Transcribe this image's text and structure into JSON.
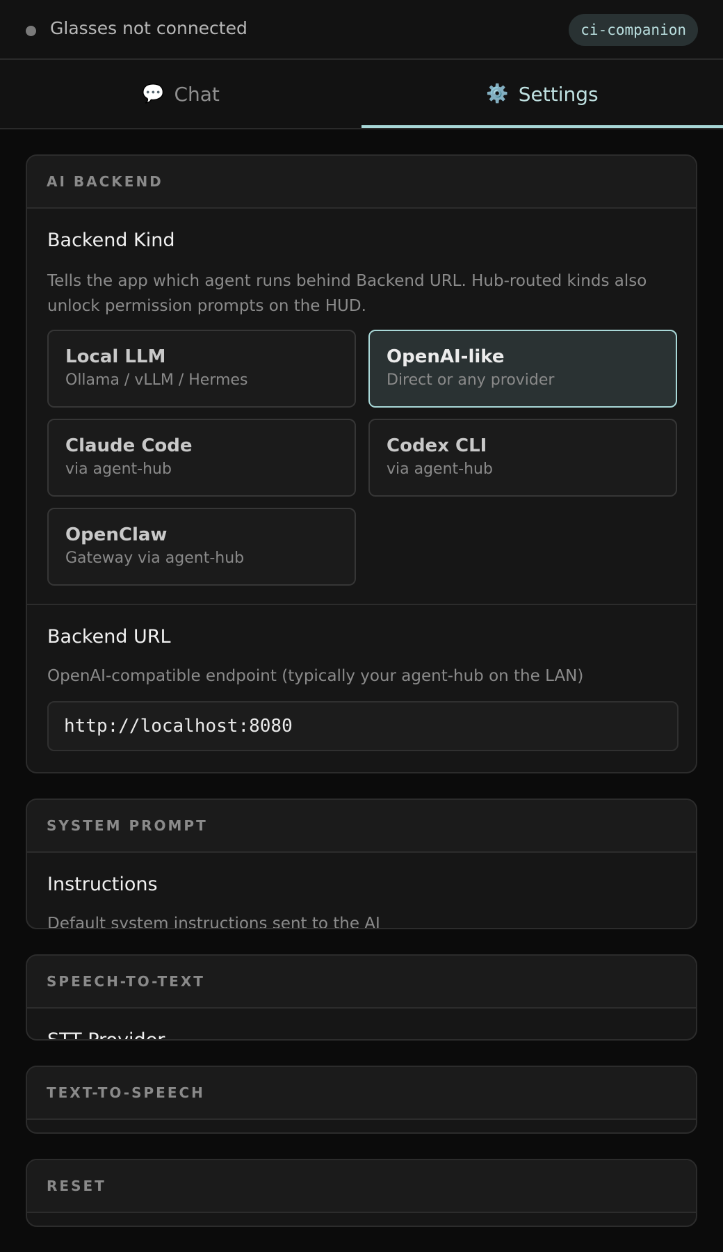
{
  "header": {
    "status_text": "Glasses not connected",
    "badge": "ci-companion"
  },
  "tabs": [
    {
      "label": "Chat",
      "icon": "💬",
      "icon_name": "chat-bubble-icon",
      "active": false
    },
    {
      "label": "Settings",
      "icon": "⚙️",
      "icon_name": "gear-icon",
      "active": true
    }
  ],
  "colors": {
    "accent": "#a7d6d6",
    "background": "#0b0b0b",
    "card": "#161616"
  },
  "ai_backend": {
    "heading": "AI BACKEND",
    "kind": {
      "label": "Backend Kind",
      "help": "Tells the app which agent runs behind Backend URL. Hub-routed kinds also unlock permission prompts on the HUD.",
      "options": [
        {
          "title": "Local LLM",
          "subtitle": "Ollama / vLLM / Hermes",
          "selected": false
        },
        {
          "title": "OpenAI-like",
          "subtitle": "Direct or any provider",
          "selected": true
        },
        {
          "title": "Claude Code",
          "subtitle": "via agent-hub",
          "selected": false
        },
        {
          "title": "Codex CLI",
          "subtitle": "via agent-hub",
          "selected": false
        },
        {
          "title": "OpenClaw",
          "subtitle": "Gateway via agent-hub",
          "selected": false
        }
      ]
    },
    "url": {
      "label": "Backend URL",
      "help": "OpenAI-compatible endpoint (typically your agent-hub on the LAN)",
      "value": "http://localhost:8080"
    }
  },
  "system_prompt": {
    "heading": "SYSTEM PROMPT",
    "label": "Instructions",
    "help": "Default system instructions sent to the AI"
  },
  "stt": {
    "heading": "SPEECH-TO-TEXT",
    "label": "STT Provider"
  },
  "tts": {
    "heading": "TEXT-TO-SPEECH"
  },
  "reset": {
    "heading": "RESET"
  }
}
